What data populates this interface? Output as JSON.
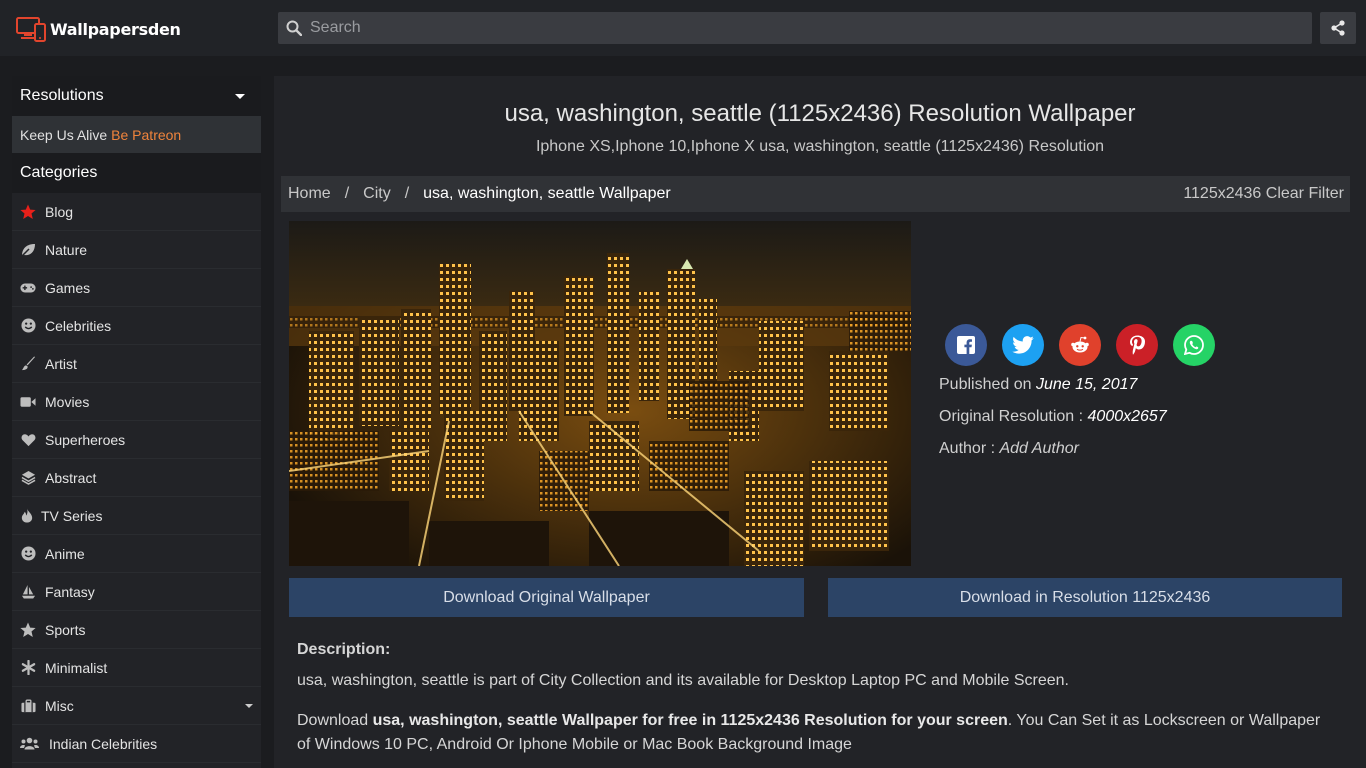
{
  "header": {
    "logo_text": "Wallpapersden",
    "search_placeholder": "Search"
  },
  "sidebar": {
    "resolutions_label": "Resolutions",
    "patreon_text": "Keep Us Alive",
    "patreon_link": "Be Patreon",
    "categories_label": "Categories",
    "items": [
      {
        "label": "Blog",
        "icon": "star-icon"
      },
      {
        "label": "Nature",
        "icon": "leaf-icon"
      },
      {
        "label": "Games",
        "icon": "gamepad-icon"
      },
      {
        "label": "Celebrities",
        "icon": "smile-icon"
      },
      {
        "label": "Artist",
        "icon": "brush-icon"
      },
      {
        "label": "Movies",
        "icon": "video-camera-icon"
      },
      {
        "label": "Superheroes",
        "icon": "heart-icon"
      },
      {
        "label": "Abstract",
        "icon": "layers-icon"
      },
      {
        "label": "TV Series",
        "icon": "fire-icon"
      },
      {
        "label": "Anime",
        "icon": "smile-icon"
      },
      {
        "label": "Fantasy",
        "icon": "ship-icon"
      },
      {
        "label": "Sports",
        "icon": "star-icon"
      },
      {
        "label": "Minimalist",
        "icon": "asterisk-icon"
      },
      {
        "label": "Misc",
        "icon": "suitcase-icon"
      },
      {
        "label": "Indian Celebrities",
        "icon": "users-icon"
      }
    ]
  },
  "main": {
    "title": "usa, washington, seattle (1125x2436) Resolution Wallpaper",
    "subtitle": "Iphone XS,Iphone 10,Iphone X usa, washington, seattle (1125x2436) Resolution",
    "breadcrumb": {
      "home": "Home",
      "sep": "/",
      "city": "City",
      "current": "usa, washington, seattle Wallpaper",
      "filter": "1125x2436 Clear Filter"
    },
    "published_label": "Published on",
    "published_value": "June 15, 2017",
    "resolution_label": "Original Resolution :",
    "resolution_value": "4000x2657",
    "author_label": "Author :",
    "author_value": "Add Author",
    "download_original": "Download Original Wallpaper",
    "download_resolution": "Download in Resolution 1125x2436",
    "description_heading": "Description:",
    "description_line1": "usa, washington, seattle is part of City Collection and its available for Desktop Laptop PC and Mobile Screen.",
    "description_line2_prefix": "Download ",
    "description_line2_bold": "usa, washington, seattle Wallpaper for free in 1125x2436 Resolution for your screen",
    "description_line2_suffix": ". You Can Set it as Lockscreen or Wallpaper of Windows 10 PC, Android Or Iphone Mobile or Mac Book Background Image"
  },
  "colors": {
    "facebook": "#3b5998",
    "twitter": "#1da1f2",
    "reddit": "#e0412c",
    "pinterest": "#cb2027",
    "whatsapp": "#25d366",
    "patreon": "#f0843c",
    "download_button": "#2c4466"
  }
}
